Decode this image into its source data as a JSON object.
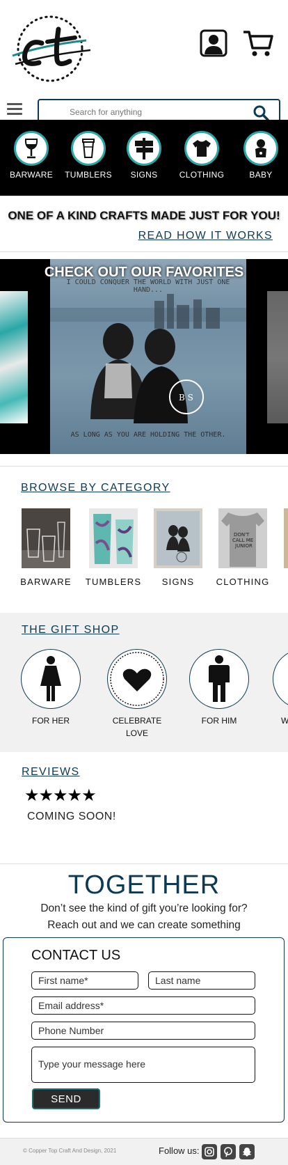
{
  "header": {
    "logo_alt": "ct",
    "account_icon": "account-icon",
    "cart_icon": "cart-icon"
  },
  "search": {
    "placeholder": "Search for anything"
  },
  "categories": [
    {
      "label": "BARWARE",
      "icon": "wine-glass-icon"
    },
    {
      "label": "TUMBLERS",
      "icon": "tumbler-icon"
    },
    {
      "label": "SIGNS",
      "icon": "signpost-icon"
    },
    {
      "label": "CLOTHING",
      "icon": "shirt-icon"
    },
    {
      "label": "BABY",
      "icon": "baby-icon"
    }
  ],
  "tagline": {
    "headline": "ONE OF A KIND CRAFTS MADE JUST FOR YOU!",
    "link": "READ HOW IT WORKS"
  },
  "favorites": {
    "title": "CHECK OUT OUR FAVORITES",
    "quote_top": "I COULD CONQUER THE WORLD WITH JUST ONE HAND...",
    "quote_bottom": "AS LONG AS YOU ARE HOLDING THE OTHER."
  },
  "browse": {
    "title": "BROWSE BY CATEGORY",
    "items": [
      "BARWARE",
      "TUMBLERS",
      "SIGNS",
      "CLOTHING"
    ]
  },
  "gift_shop": {
    "title": "THE GIFT SHOP",
    "items": [
      {
        "label_1": "FOR HER",
        "label_2": ""
      },
      {
        "label_1": "CELEBRATE",
        "label_2": "LOVE"
      },
      {
        "label_1": "FOR HIM",
        "label_2": ""
      },
      {
        "label_1": "W",
        "label_2": ""
      }
    ]
  },
  "reviews": {
    "title": "REVIEWS",
    "stars": "★★★★★",
    "text": "COMING SOON!"
  },
  "together": {
    "title": "TOGETHER",
    "line1": "Don’t see the kind of gift you’re looking for?",
    "line2": "Reach out and we can create something"
  },
  "contact": {
    "title": "CONTACT US",
    "first_name": "First name*",
    "last_name": "Last name",
    "email": "Email address*",
    "phone": "Phone Number",
    "message": "Type your message here",
    "send": "SEND"
  },
  "footer": {
    "copyright": "© Copper Top Craft And Design, 2021",
    "follow": "Follow us:"
  },
  "colors": {
    "brand_navy": "#0b3a52",
    "accent_teal": "#2aa7a7"
  }
}
